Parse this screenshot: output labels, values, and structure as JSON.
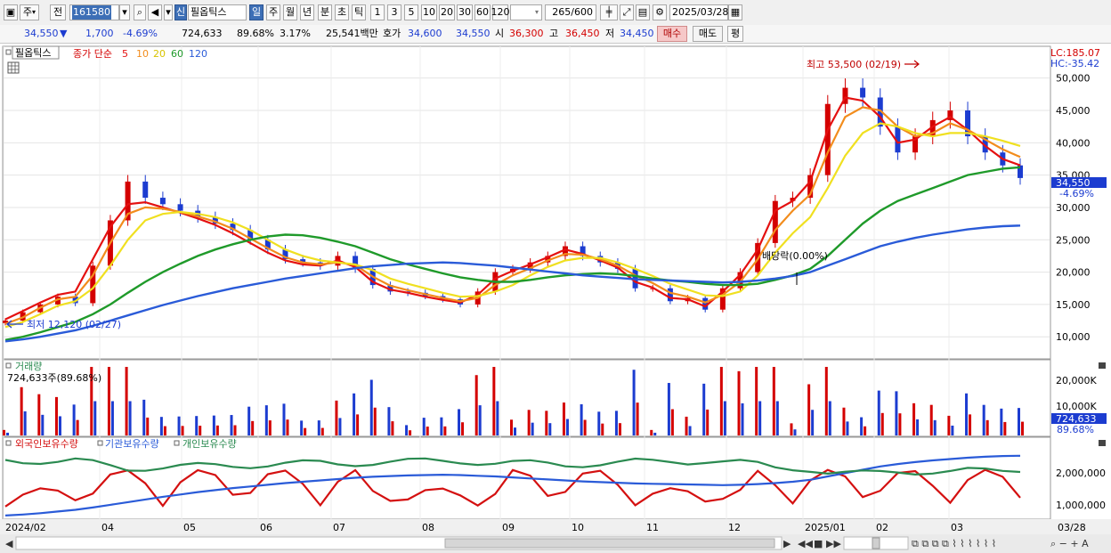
{
  "toolbar": {
    "market": "주",
    "prev_label": "전",
    "code": "161580",
    "badge": "신",
    "name": "필옵틱스",
    "periods": [
      "일",
      "주",
      "월",
      "년",
      "분",
      "초",
      "틱"
    ],
    "active_period": "일",
    "minutes": [
      "1",
      "3",
      "5",
      "10",
      "20",
      "30",
      "60",
      "120"
    ],
    "count": "265/600",
    "date": "2025/03/28"
  },
  "quote": {
    "price": "34,550",
    "direction": "▼",
    "change": "1,700",
    "change_pct": "-4.69%",
    "volume": "724,633",
    "vol_ratio": "89.68%",
    "turnover": "3.17%",
    "amount": "25,541백만",
    "bid_label": "호가",
    "bid_ask": "34,600",
    "bid": "34,550",
    "open_label": "시",
    "open": "36,300",
    "high_label": "고",
    "high": "36,450",
    "low_label": "저",
    "low": "34,450",
    "buy_btn": "매수",
    "sell_btn": "매도",
    "eval_btn": "평"
  },
  "legend": {
    "stock": "필옵틱스",
    "ma_label": "종가 단순",
    "ma": [
      {
        "label": "5",
        "color": "#e41010"
      },
      {
        "label": "10",
        "color": "#f28c1c"
      },
      {
        "label": "20",
        "color": "#f0e020"
      },
      {
        "label": "60",
        "color": "#1f9a2a"
      },
      {
        "label": "120",
        "color": "#2a5bd8"
      }
    ]
  },
  "lc": "LC:185.07",
  "hc": "HC:-35.42",
  "annotations": {
    "high": "최고 53,500 (02/19)",
    "low": "최저 12,120 (02/27)",
    "dividend": "배당락(0.00%)"
  },
  "price_axis": [
    "50,000",
    "45,000",
    "40,000",
    "35,000",
    "30,000",
    "25,000",
    "20,000",
    "15,000",
    "10,000"
  ],
  "price_tag": {
    "value": "34,550",
    "pct": "-4.69%"
  },
  "volume_panel": {
    "title": "거래량",
    "value": "724,633주(89.68%)",
    "axis": [
      "20,000K",
      "10,000K"
    ],
    "tag": "724,633",
    "tag_pct": "89.68%"
  },
  "holdings_panel": {
    "series": [
      {
        "name": "외국인보유수량",
        "color": "#d41010"
      },
      {
        "name": "기관보유수량",
        "color": "#2a5bd8"
      },
      {
        "name": "개인보유수량",
        "color": "#2a8a50"
      }
    ],
    "axis": [
      "2,000,000",
      "1,000,000"
    ]
  },
  "x_axis": [
    "2024/02",
    "04",
    "05",
    "06",
    "07",
    "08",
    "09",
    "10",
    "11",
    "12",
    "2025/01",
    "02",
    "03",
    "03/28"
  ],
  "colors": {
    "up": "#d40000",
    "down": "#1c3cd0",
    "accent": "#3d6fb6"
  },
  "chart_data": {
    "type": "line",
    "title": "필옵틱스",
    "ylim": [
      7000,
      54500
    ],
    "series": [
      {
        "name": "종가",
        "values": [
          12500,
          13800,
          15000,
          16200,
          15200,
          21000,
          28000,
          34000,
          31500,
          30500,
          29500,
          28500,
          27500,
          26500,
          25000,
          23500,
          22000,
          21500,
          21000,
          22500,
          20500,
          18000,
          17000,
          16800,
          16300,
          15800,
          15000,
          17000,
          20000,
          20500,
          21500,
          22500,
          24000,
          22500,
          21500,
          20500,
          17500,
          17500,
          15500,
          16000,
          14200,
          17500,
          20000,
          24500,
          31000,
          31500,
          35000,
          46000,
          48500,
          47000,
          42500,
          38500,
          41000,
          43500,
          45000,
          41000,
          38500,
          36500,
          34550
        ]
      },
      {
        "name": "5",
        "values": [
          12700,
          14000,
          15300,
          16500,
          17000,
          22000,
          27000,
          30500,
          30800,
          30000,
          29200,
          28300,
          27300,
          26000,
          24500,
          23000,
          21800,
          21200,
          21000,
          21800,
          20800,
          18500,
          17300,
          16800,
          16200,
          15700,
          15300,
          16500,
          19000,
          20200,
          21200,
          22300,
          23500,
          22800,
          21800,
          20700,
          18500,
          17600,
          16000,
          15800,
          14700,
          17000,
          19600,
          23500,
          29500,
          31000,
          34000,
          42000,
          47000,
          46500,
          44000,
          40000,
          40500,
          42500,
          44000,
          42000,
          39500,
          37500,
          36500
        ]
      },
      {
        "name": "10",
        "values": [
          12000,
          13000,
          14500,
          15800,
          16200,
          19500,
          24500,
          29000,
          30000,
          29800,
          29300,
          28600,
          27800,
          26700,
          25200,
          23700,
          22300,
          21500,
          21200,
          21500,
          21100,
          19300,
          17900,
          17200,
          16600,
          16000,
          15500,
          16000,
          18000,
          19500,
          20600,
          21800,
          22800,
          22700,
          22000,
          21000,
          19500,
          18300,
          16800,
          16200,
          15300,
          16500,
          18500,
          22000,
          26500,
          29500,
          32000,
          38500,
          44000,
          45500,
          45000,
          42500,
          41000,
          41500,
          43000,
          42000,
          40500,
          39000,
          37800
        ]
      },
      {
        "name": "20",
        "values": [
          11500,
          12300,
          13500,
          14800,
          15500,
          17500,
          21000,
          25000,
          28000,
          29000,
          29300,
          29000,
          28500,
          27700,
          26500,
          25000,
          23500,
          22500,
          21800,
          21500,
          21200,
          20300,
          19000,
          18200,
          17500,
          16800,
          16200,
          16300,
          17000,
          18000,
          19500,
          20800,
          21800,
          22200,
          22200,
          21500,
          20500,
          19400,
          18200,
          17300,
          16400,
          16300,
          17000,
          19500,
          23000,
          26000,
          28500,
          33000,
          38000,
          41500,
          43000,
          42500,
          41500,
          41000,
          41500,
          41500,
          41000,
          40300,
          39500
        ]
      },
      {
        "name": "60",
        "values": [
          9500,
          10000,
          10700,
          11500,
          12300,
          13500,
          15000,
          16800,
          18500,
          20000,
          21300,
          22500,
          23500,
          24300,
          25000,
          25500,
          25800,
          25700,
          25300,
          24700,
          24000,
          23000,
          22000,
          21200,
          20500,
          19800,
          19200,
          18800,
          18500,
          18500,
          18800,
          19200,
          19500,
          19700,
          19800,
          19700,
          19400,
          19000,
          18700,
          18500,
          18200,
          18000,
          18000,
          18200,
          18800,
          19500,
          20500,
          22500,
          25000,
          27500,
          29500,
          31000,
          32000,
          33000,
          34000,
          35000,
          35500,
          36000,
          36200
        ]
      },
      {
        "name": "120",
        "values": [
          9300,
          9600,
          10000,
          10500,
          11000,
          11700,
          12500,
          13300,
          14100,
          14900,
          15600,
          16300,
          16900,
          17500,
          18000,
          18500,
          19000,
          19400,
          19800,
          20200,
          20600,
          20900,
          21100,
          21300,
          21400,
          21500,
          21400,
          21200,
          21000,
          20700,
          20400,
          20100,
          19800,
          19500,
          19300,
          19100,
          18900,
          18800,
          18700,
          18600,
          18500,
          18400,
          18500,
          18700,
          19000,
          19400,
          20000,
          21000,
          22000,
          23000,
          24000,
          24700,
          25300,
          25800,
          26200,
          26600,
          26900,
          27100,
          27200
        ]
      }
    ]
  }
}
